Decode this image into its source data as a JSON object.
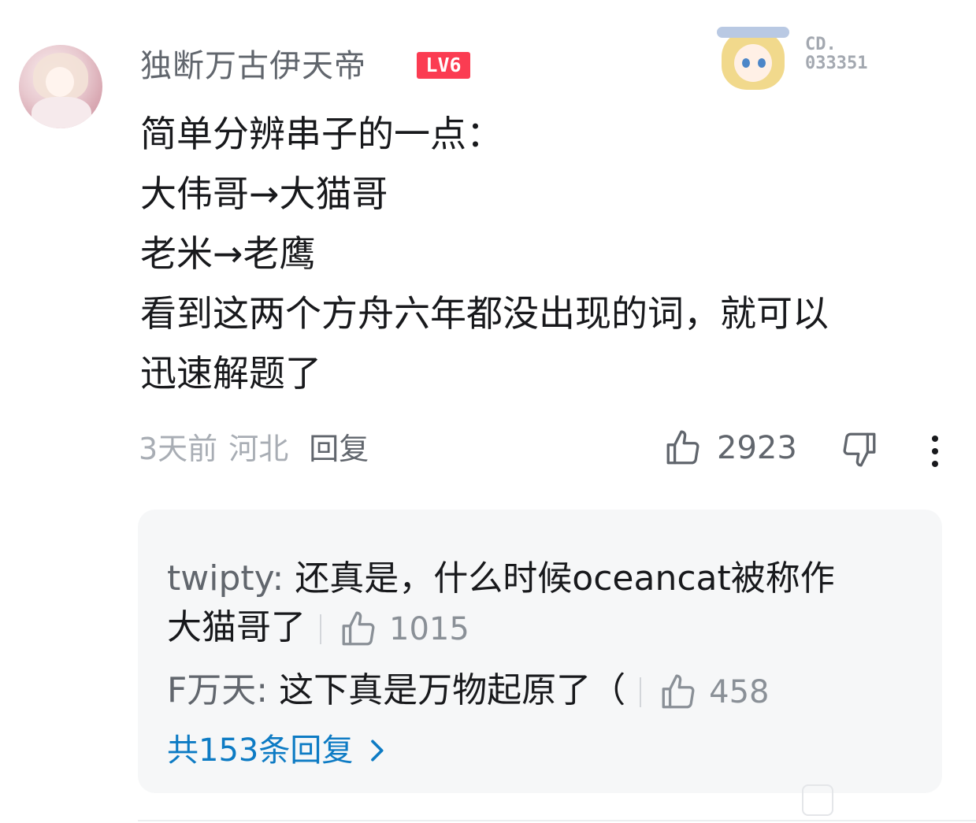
{
  "comment": {
    "username": "独断万古伊天帝",
    "level_badge": "LV6",
    "card_number": [
      "CD.",
      "033351"
    ],
    "content_lines": [
      "简单分辨串子的一点：",
      "大伟哥→大猫哥",
      "老米→老鹰",
      "看到这两个方舟六年都没出现的词，就可以",
      "迅速解题了"
    ],
    "time": "3天前",
    "location": "河北",
    "reply_label": "回复",
    "like_count": "2923"
  },
  "sub_replies": [
    {
      "user": "twipty:",
      "text_line1": "还真是，什么时候oceancat被称作",
      "text_line2": "大猫哥了",
      "likes": "1015"
    },
    {
      "user": "F万天:",
      "text": "这下真是万物起原了（",
      "likes": "458"
    }
  ],
  "more_replies_label": "共153条回复",
  "icons": [
    "thumb-up-icon",
    "thumb-down-icon",
    "more-vertical-icon",
    "chevron-right-icon"
  ],
  "colors": {
    "level_badge": "#fb3c52",
    "link": "#0d7bc4",
    "muted": "#a8adb4",
    "sub_bg": "#f6f7f8"
  }
}
